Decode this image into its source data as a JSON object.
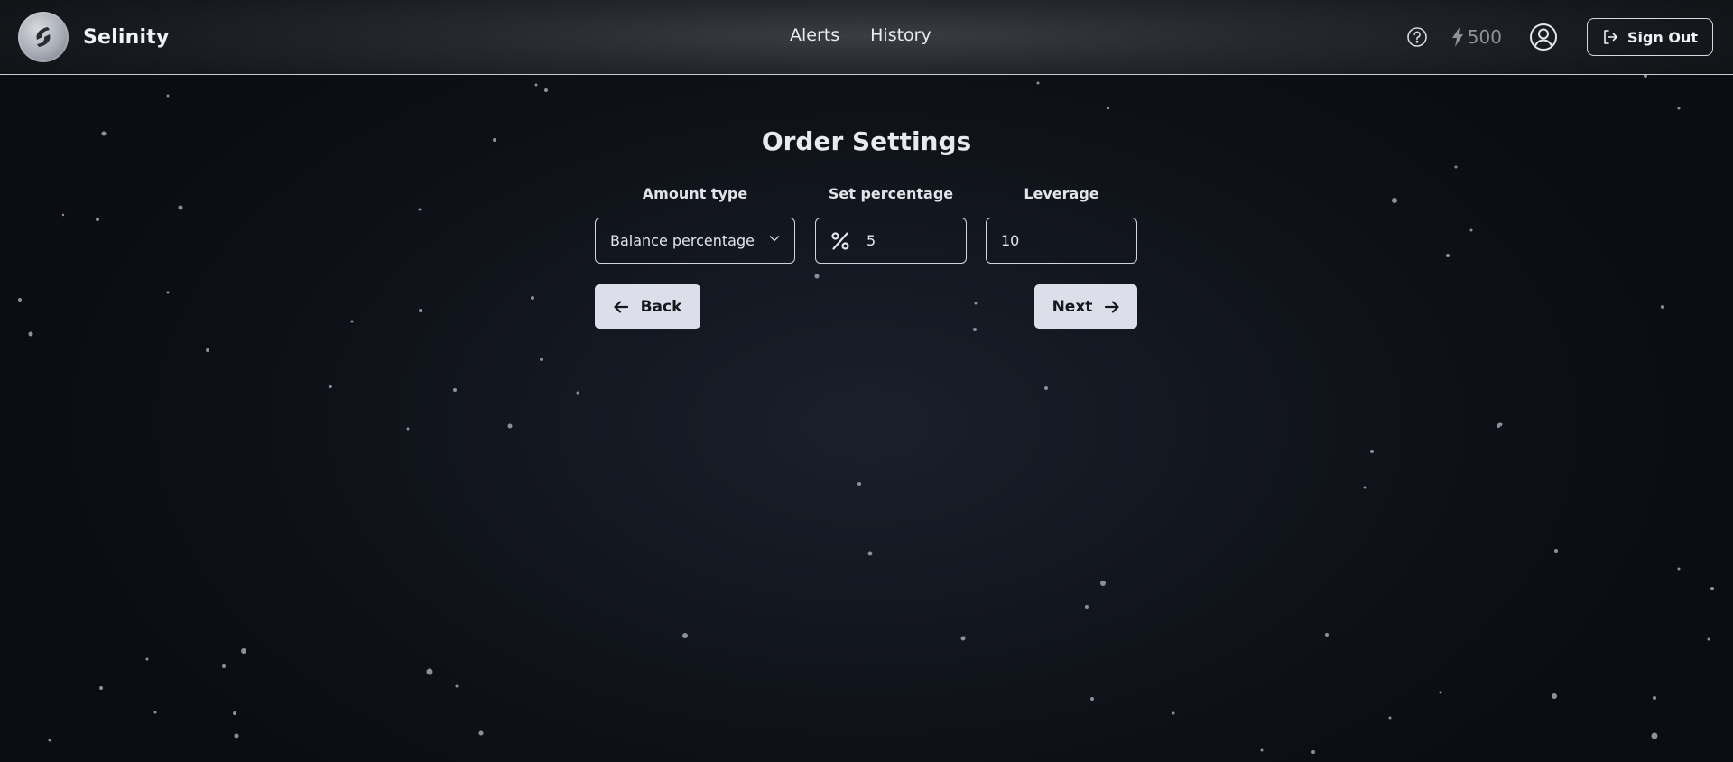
{
  "app": {
    "name": "Selinity"
  },
  "nav": {
    "items": [
      "Alerts",
      "History"
    ]
  },
  "header": {
    "credits": "500",
    "sign_out_label": "Sign Out"
  },
  "icons": {
    "logo": "selinity-logo-icon",
    "help": "help-circle-icon",
    "credits": "lightning-icon",
    "user": "user-circle-icon",
    "sign_out": "sign-out-icon",
    "chevron": "chevron-down-icon",
    "percent": "percent-icon",
    "back": "arrow-left-icon",
    "next": "arrow-right-icon"
  },
  "form": {
    "title": "Order Settings",
    "amount_type": {
      "label": "Amount type",
      "value": "Balance percentage"
    },
    "set_percentage": {
      "label": "Set percentage",
      "value": "5"
    },
    "leverage": {
      "label": "Leverage",
      "value": "10"
    },
    "back_label": "Back",
    "next_label": "Next"
  },
  "colors": {
    "background": "#0b0d12",
    "button_bg": "#dcdfe9",
    "border": "#d2d5dd",
    "muted": "#8d919b"
  }
}
